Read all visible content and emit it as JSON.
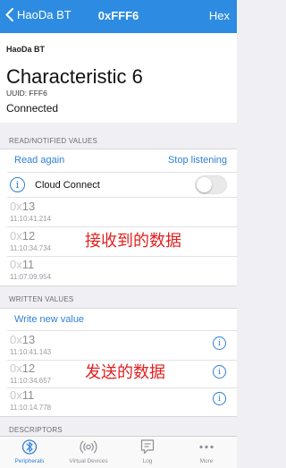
{
  "nav": {
    "back_label": "HaoDa BT",
    "title": "0xFFF6",
    "right_label": "Hex"
  },
  "header": {
    "device_name": "HaoDa BT",
    "characteristic": "Characteristic 6",
    "uuid": "UUID: FFF6",
    "status": "Connected"
  },
  "read_section": {
    "label": "READ/NOTIFIED VALUES",
    "read_again": "Read again",
    "stop_listening": "Stop listening",
    "cloud_connect": "Cloud Connect",
    "cloud_connect_on": false,
    "values": [
      {
        "prefix": "0x",
        "hex": "13",
        "time": "11:10:41.214"
      },
      {
        "prefix": "0x",
        "hex": "12",
        "time": "11:10:34.734"
      },
      {
        "prefix": "0x",
        "hex": "11",
        "time": "11:07:09.954"
      }
    ],
    "annotation": "接收到的数据"
  },
  "written_section": {
    "label": "WRITTEN VALUES",
    "write_new": "Write new value",
    "values": [
      {
        "prefix": "0x",
        "hex": "13",
        "time": "11:10:41.143"
      },
      {
        "prefix": "0x",
        "hex": "12",
        "time": "11:10:34.657"
      },
      {
        "prefix": "0x",
        "hex": "11",
        "time": "11:10:14.778"
      }
    ],
    "annotation": "发送的数据"
  },
  "descriptors_section": {
    "label": "DESCRIPTORS"
  },
  "tabbar": {
    "tabs": [
      {
        "label": "Peripherals",
        "icon": "peripherals-icon",
        "active": true
      },
      {
        "label": "Virtual Devices",
        "icon": "broadcast-icon",
        "active": false
      },
      {
        "label": "Log",
        "icon": "log-icon",
        "active": false
      },
      {
        "label": "More",
        "icon": "more-icon",
        "active": false
      }
    ]
  },
  "colors": {
    "accent": "#2d8ce2",
    "link": "#2f7fd6",
    "annotation": "#e32020"
  }
}
